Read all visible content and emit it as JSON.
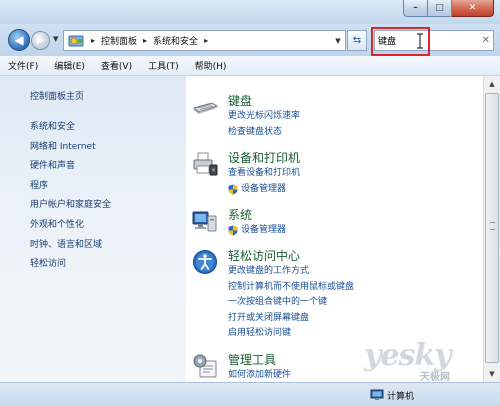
{
  "window": {
    "min_glyph": "–",
    "max_glyph": "□",
    "close_glyph": "✕"
  },
  "nav": {
    "back_glyph": "◀",
    "forward_glyph": "▶"
  },
  "address": {
    "segments": [
      "控制面板",
      "系统和安全"
    ],
    "separator": "▸"
  },
  "refresh_glyph": "⇆",
  "search": {
    "value": "键盘",
    "clear_glyph": "✕"
  },
  "menu": [
    "文件(F)",
    "编辑(E)",
    "查看(V)",
    "工具(T)",
    "帮助(H)"
  ],
  "sidebar": {
    "home": "控制面板主页",
    "items": [
      "系统和安全",
      "网络和 Internet",
      "硬件和声音",
      "程序",
      "用户帐户和家庭安全",
      "外观和个性化",
      "时钟、语言和区域",
      "轻松访问"
    ]
  },
  "results": [
    {
      "icon": "keyboard-icon",
      "title": "键盘",
      "links": [
        {
          "text": "更改光标闪烁速率",
          "shield": false
        },
        {
          "text": "检查键盘状态",
          "shield": false
        }
      ]
    },
    {
      "icon": "printer-icon",
      "title": "设备和打印机",
      "links": [
        {
          "text": "查看设备和打印机",
          "shield": false
        },
        {
          "text": "设备管理器",
          "shield": true
        }
      ]
    },
    {
      "icon": "system-icon",
      "title": "系统",
      "links": [
        {
          "text": "设备管理器",
          "shield": true
        }
      ]
    },
    {
      "icon": "ease-of-access-icon",
      "title": "轻松访问中心",
      "links": [
        {
          "text": "更改键盘的工作方式",
          "shield": false
        },
        {
          "text": "控制计算机而不使用鼠标或键盘",
          "shield": false
        },
        {
          "text": "一次按组合键中的一个键",
          "shield": false
        },
        {
          "text": "打开或关闭屏幕键盘",
          "shield": false
        },
        {
          "text": "启用轻松访问键",
          "shield": false
        }
      ]
    },
    {
      "icon": "admin-tools-icon",
      "title": "管理工具",
      "links": [
        {
          "text": "如何添加新硬件",
          "shield": false
        }
      ]
    }
  ],
  "status": {
    "text": "计算机"
  },
  "watermark": {
    "brand": "yesky",
    "sub": "天极网"
  },
  "colors": {
    "category_title": "#1a5c31",
    "link": "#1a4e97",
    "highlight_box": "#d9262b"
  }
}
